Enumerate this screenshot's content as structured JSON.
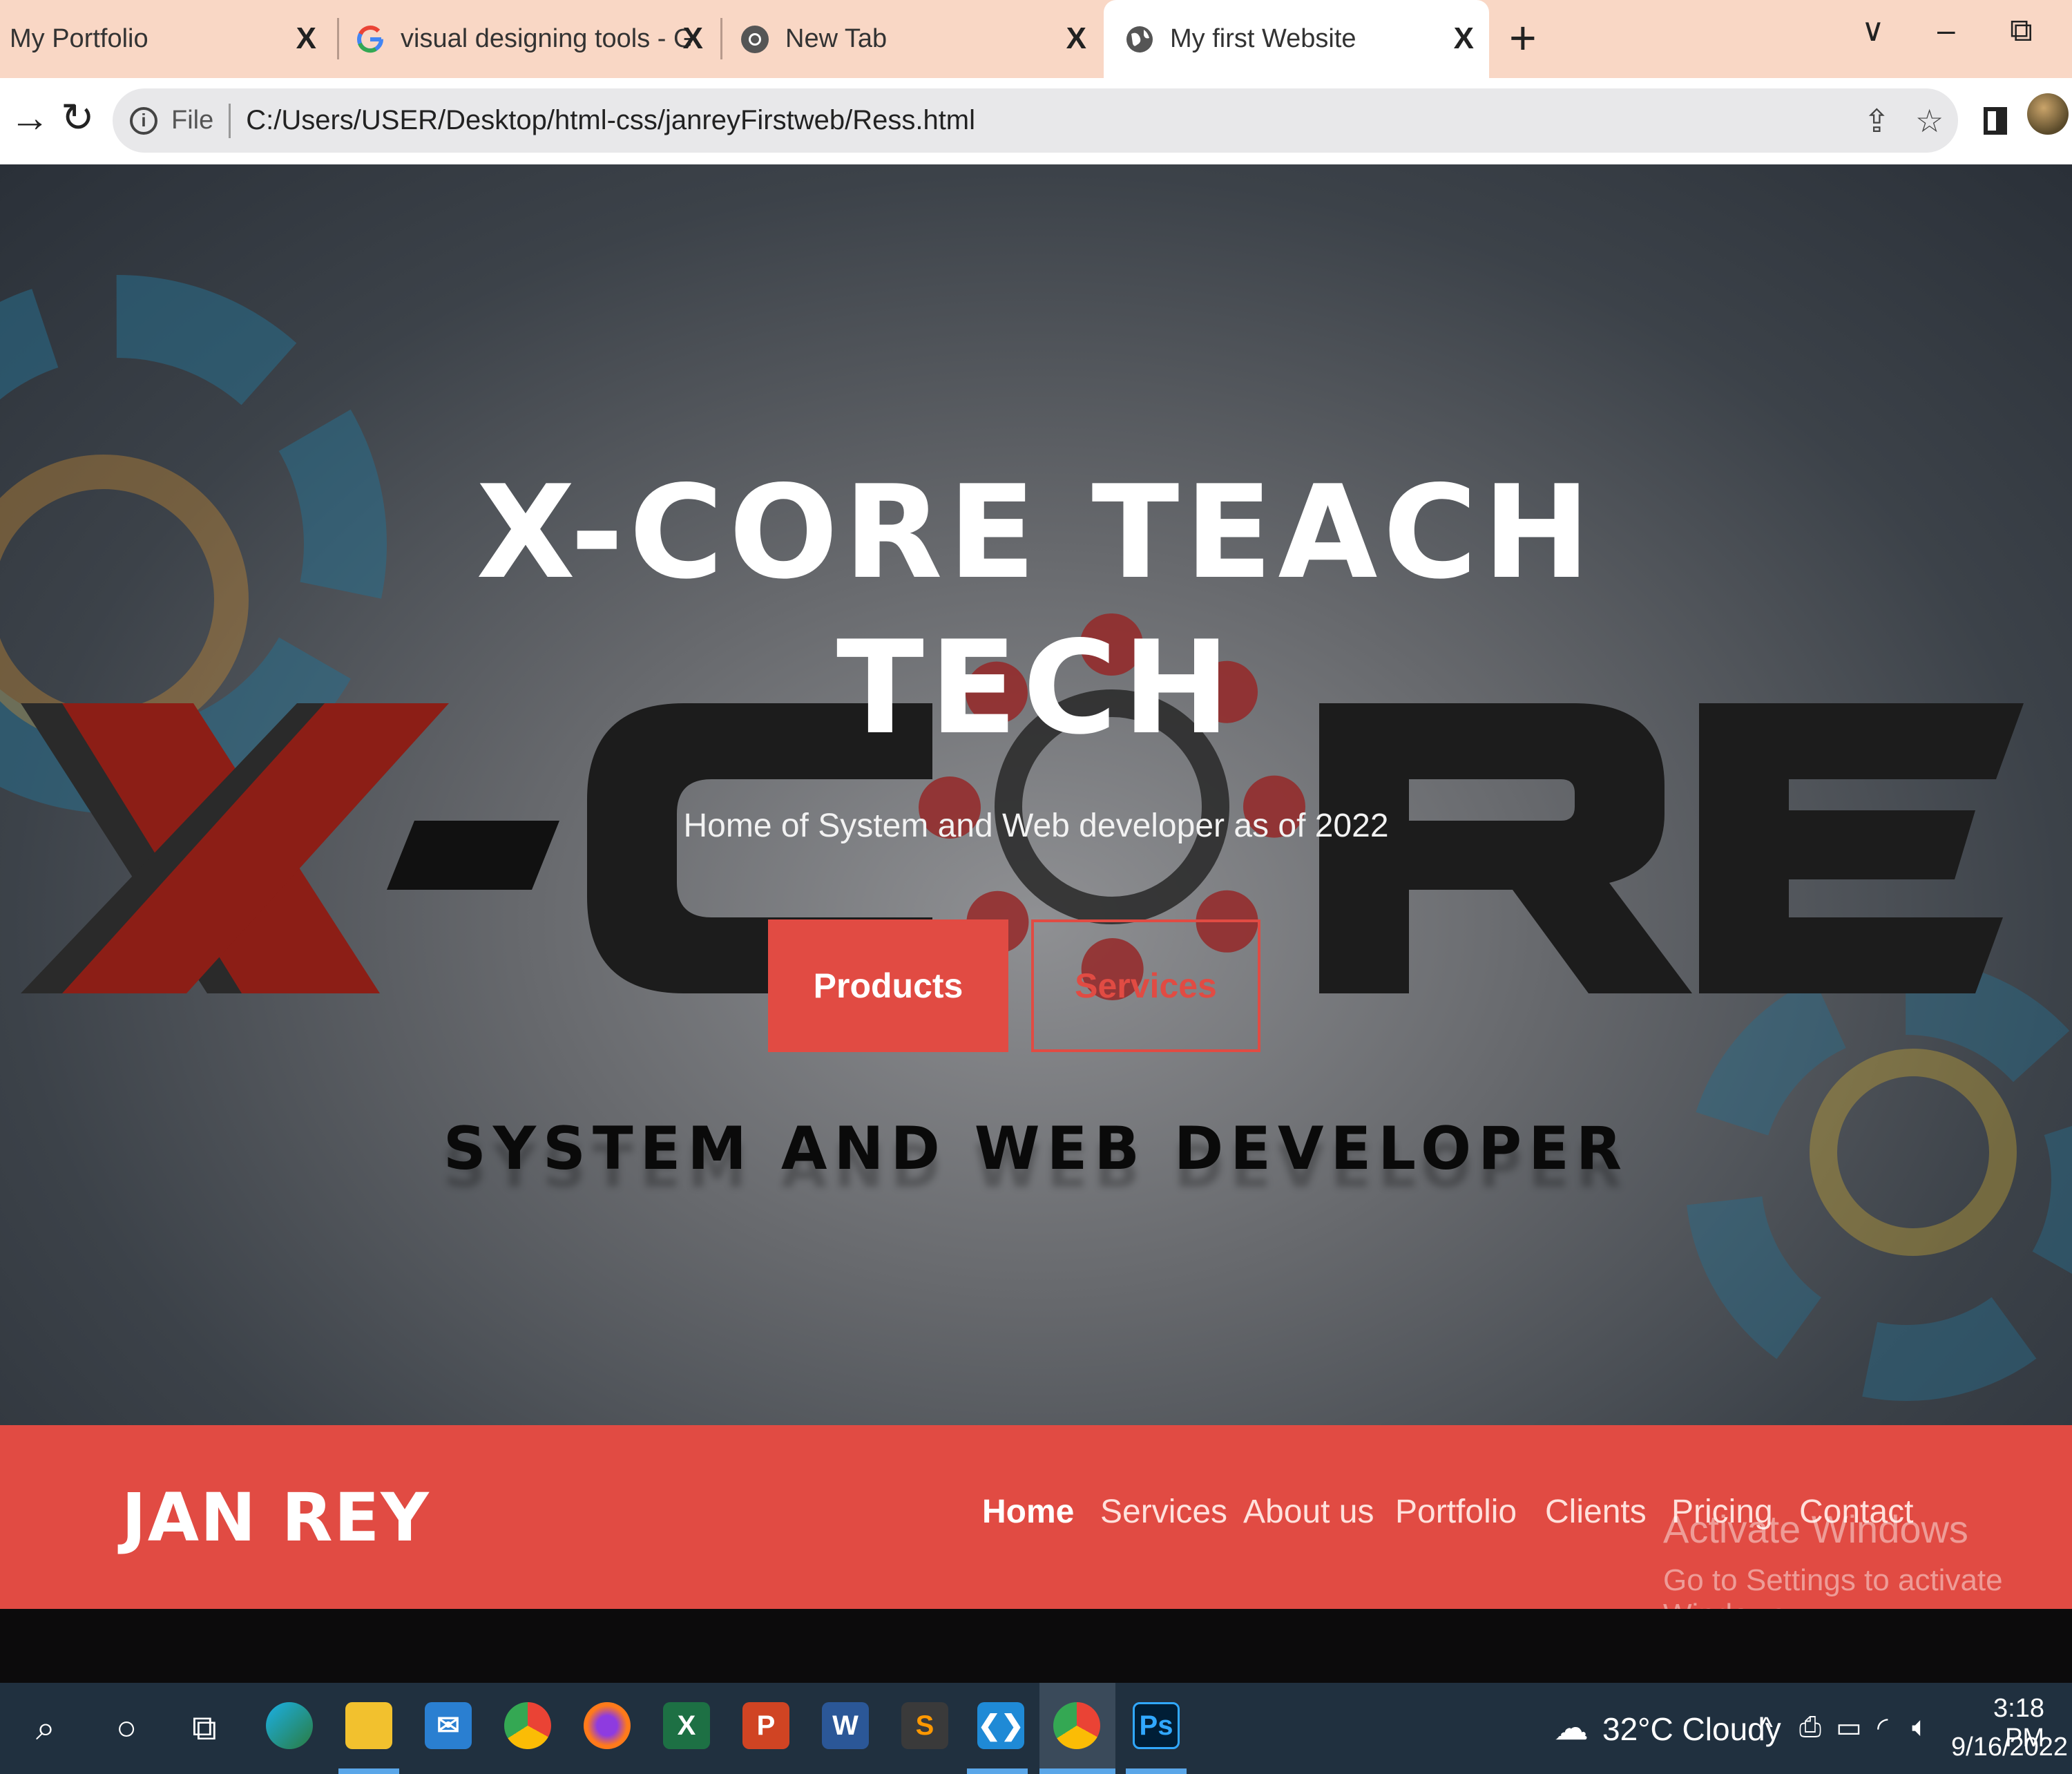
{
  "browser": {
    "tabs": [
      {
        "title": "My Portfolio",
        "close": "X"
      },
      {
        "title": "visual designing tools - Google S",
        "close": "X"
      },
      {
        "title": "New Tab",
        "close": "X"
      },
      {
        "title": "My first Website",
        "close": "X"
      }
    ],
    "new_tab": "+",
    "window_controls": {
      "dropdown": "∨",
      "minimize": "–",
      "restore": "⧉"
    },
    "address": {
      "scheme_label": "File",
      "url": "C:/Users/USER/Desktop/html-css/janreyFirstweb/Ress.html"
    }
  },
  "hero": {
    "title_line1": "X-Core Teach",
    "title_line2": "Tech",
    "subtitle": "Home of System and Web developer as of 2022",
    "products_label": "Products",
    "services_label": "Services",
    "tagline": "System and Web Developer"
  },
  "site_nav": {
    "logo": "JAN REY",
    "links": [
      "Home",
      "Services",
      "About us",
      "Portfolio",
      "Clients",
      "Pricing",
      "Contact"
    ]
  },
  "watermark": {
    "line1": "Activate Windows",
    "line2": "Go to Settings to activate Windows."
  },
  "taskbar": {
    "weather": "32°C  Cloudy",
    "time": "3:18 PM",
    "date": "9/16/2022"
  },
  "colors": {
    "accent": "#e14b43",
    "tabstrip": "#f9d7c5",
    "taskbar": "#20303f"
  }
}
